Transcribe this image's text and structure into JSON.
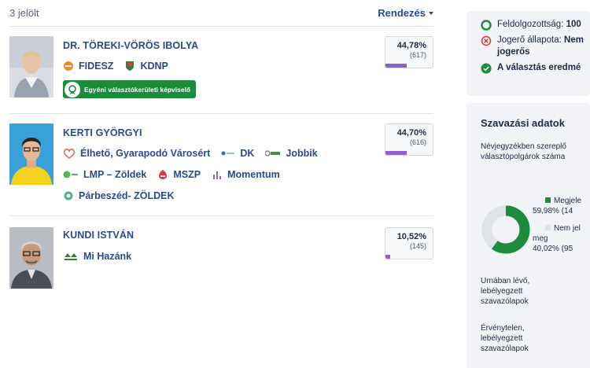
{
  "list": {
    "count_text": "3 jelölt",
    "sort_label": "Rendezés"
  },
  "candidates": [
    {
      "name": "DR. TÖREKI-VÖRÖS IBOLYA",
      "parties": [
        "FIDESZ",
        "KDNP"
      ],
      "badge": "Egyéni választókerületi képviselő",
      "percent": "44,78%",
      "votes": "(617)",
      "share": 0.4478
    },
    {
      "name": "KERTI GYÖRGYI",
      "parties": [
        "Élhető, Gyarapodó Városért",
        "DK",
        "Jobbik",
        "LMP – Zöldek",
        "MSZP",
        "Momentum",
        "Párbeszéd- ZÖLDEK"
      ],
      "percent": "44,70%",
      "votes": "(616)",
      "share": 0.447
    },
    {
      "name": "KUNDI ISTVÁN",
      "parties": [
        "Mi Hazánk"
      ],
      "percent": "10,52%",
      "votes": "(145)",
      "share": 0.1052
    }
  ],
  "status": {
    "processed_label": "Feldolgozottság:",
    "processed_value": "100",
    "legal_label": "Jogerő állapota:",
    "legal_value": "Nem",
    "legal_value_2": "jogerős",
    "result_text": "A választás eredmé"
  },
  "voting": {
    "title": "Szavazási adatok",
    "registered_label": "Névjegyzékben szereplő választópolgárok száma",
    "appeared_label": "Megjele",
    "appeared_value": "59,98% (14",
    "not_appeared_label": "Nem jel",
    "not_appeared_label_2": "meg",
    "not_appeared_value": "40,02% (95",
    "appeared_share": 0.5998,
    "ballots_label": "Urnában lévő, lebélyegzett szavazólapok",
    "invalid_label": "Érvénytelen, lebélyegzett szavazólapok"
  },
  "colors": {
    "accent": "#2a4a8f",
    "bar": "#8e63c9",
    "green": "#1c8b3b",
    "red": "#d63a3a",
    "grey": "#dfe2e6"
  },
  "icons": {
    "processed": "check-circle-outline-icon",
    "legal": "x-circle-icon",
    "result": "check-circle-filled-icon"
  }
}
